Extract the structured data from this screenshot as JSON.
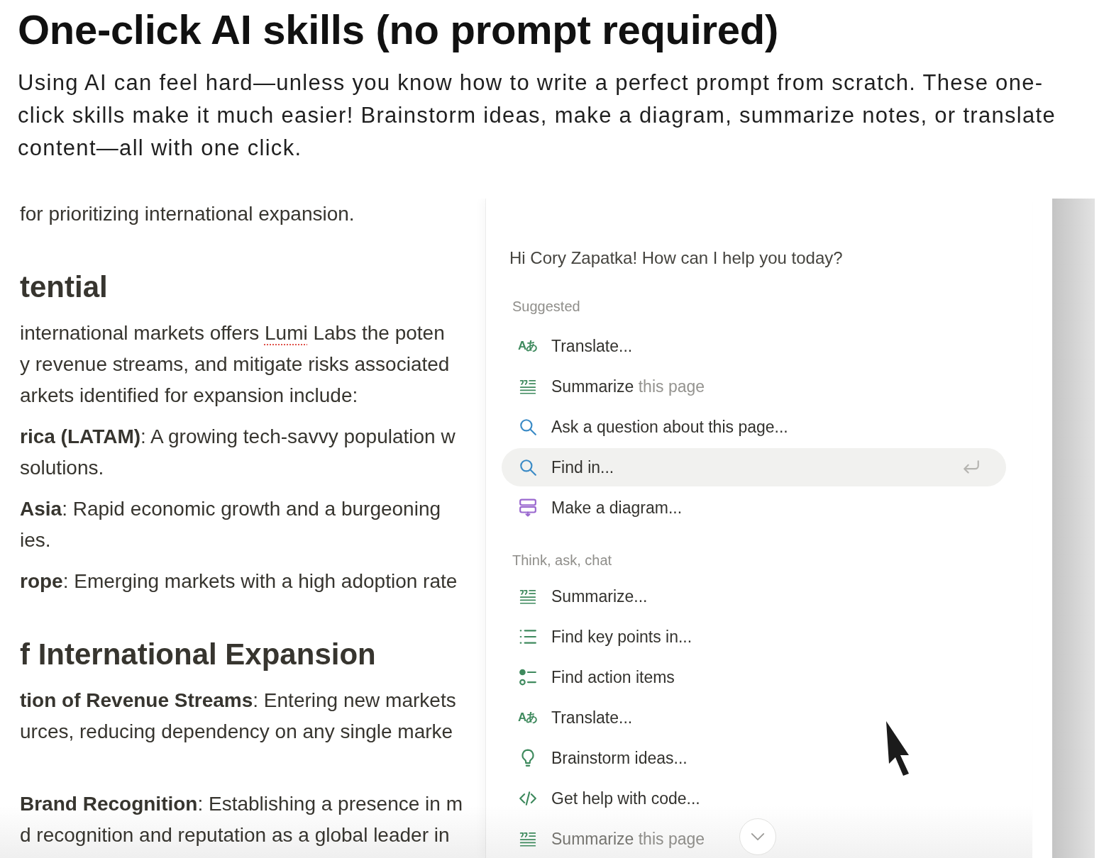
{
  "header": {
    "title": "One-click AI skills (no prompt required)",
    "description": "Using AI can feel hard—unless you know how to write a perfect prompt from scratch. These one-click skills make it much easier! Brainstorm ideas, make a diagram, summarize notes, or translate content—all with one click."
  },
  "document": {
    "blocks": [
      {
        "kind": "paragraph",
        "lines": [
          [
            {
              "kind": "plain",
              "text": "for prioritizing international expansion."
            }
          ]
        ]
      },
      {
        "kind": "heading",
        "text": "tential"
      },
      {
        "kind": "paragraph",
        "lines": [
          [
            {
              "kind": "plain",
              "text": "international markets offers "
            },
            {
              "kind": "flagged",
              "text": "Lumi"
            },
            {
              "kind": "plain",
              "text": " Labs the poten"
            }
          ],
          [
            {
              "kind": "plain",
              "text": "y revenue streams, and mitigate risks associated"
            }
          ],
          [
            {
              "kind": "plain",
              "text": "arkets identified for expansion include:"
            }
          ]
        ]
      },
      {
        "kind": "paragraph",
        "lines": [
          [
            {
              "kind": "bold",
              "text": "rica (LATAM)"
            },
            {
              "kind": "plain",
              "text": ": A growing tech-savvy population w"
            }
          ],
          [
            {
              "kind": "plain",
              "text": "solutions."
            }
          ]
        ]
      },
      {
        "kind": "paragraph",
        "lines": [
          [
            {
              "kind": "bold",
              "text": "Asia"
            },
            {
              "kind": "plain",
              "text": ": Rapid economic growth and a burgeoning"
            }
          ],
          [
            {
              "kind": "plain",
              "text": "ies."
            }
          ]
        ]
      },
      {
        "kind": "paragraph",
        "lines": [
          [
            {
              "kind": "bold",
              "text": "rope"
            },
            {
              "kind": "plain",
              "text": ": Emerging markets with a high adoption rate"
            }
          ]
        ]
      },
      {
        "kind": "heading",
        "text": "f International Expansion"
      },
      {
        "kind": "paragraph",
        "lines": [
          [
            {
              "kind": "bold",
              "text": "tion of Revenue Streams"
            },
            {
              "kind": "plain",
              "text": ": Entering new markets"
            }
          ],
          [
            {
              "kind": "plain",
              "text": "urces, reducing dependency on any single marke"
            }
          ]
        ]
      },
      {
        "kind": "blank"
      },
      {
        "kind": "paragraph",
        "lines": [
          [
            {
              "kind": "bold",
              "text": "Brand Recognition"
            },
            {
              "kind": "plain",
              "text": ": Establishing a presence in m"
            }
          ],
          [
            {
              "kind": "plain",
              "text": "d recognition and reputation as a global leader in"
            }
          ]
        ]
      }
    ]
  },
  "ai_panel": {
    "greeting": "Hi Cory Zapatka! How can I help you today?",
    "sections": [
      {
        "title": "Suggested",
        "items": [
          {
            "kind": "translate",
            "glyph": "Aあ",
            "label": "Translate...",
            "selected": false
          },
          {
            "kind": "summarize",
            "label": "Summarize",
            "hint": "this page",
            "selected": false
          },
          {
            "kind": "search",
            "label": "Ask a question about this page...",
            "selected": false
          },
          {
            "kind": "search",
            "label": "Find in...",
            "selected": true
          },
          {
            "kind": "diagram",
            "label": "Make a diagram...",
            "selected": false
          }
        ]
      },
      {
        "title": "Think, ask, chat",
        "items": [
          {
            "kind": "summarize",
            "label": "Summarize...",
            "selected": false
          },
          {
            "kind": "list",
            "label": "Find key points in...",
            "selected": false
          },
          {
            "kind": "checklist",
            "label": "Find action items",
            "selected": false
          },
          {
            "kind": "translate",
            "glyph": "Aあ",
            "label": "Translate...",
            "selected": false
          },
          {
            "kind": "bulb",
            "label": "Brainstorm ideas...",
            "selected": false
          },
          {
            "kind": "code",
            "label": "Get help with code...",
            "selected": false
          },
          {
            "kind": "summarize",
            "label": "Summarize",
            "hint": "this page",
            "selected": false
          }
        ]
      }
    ]
  }
}
